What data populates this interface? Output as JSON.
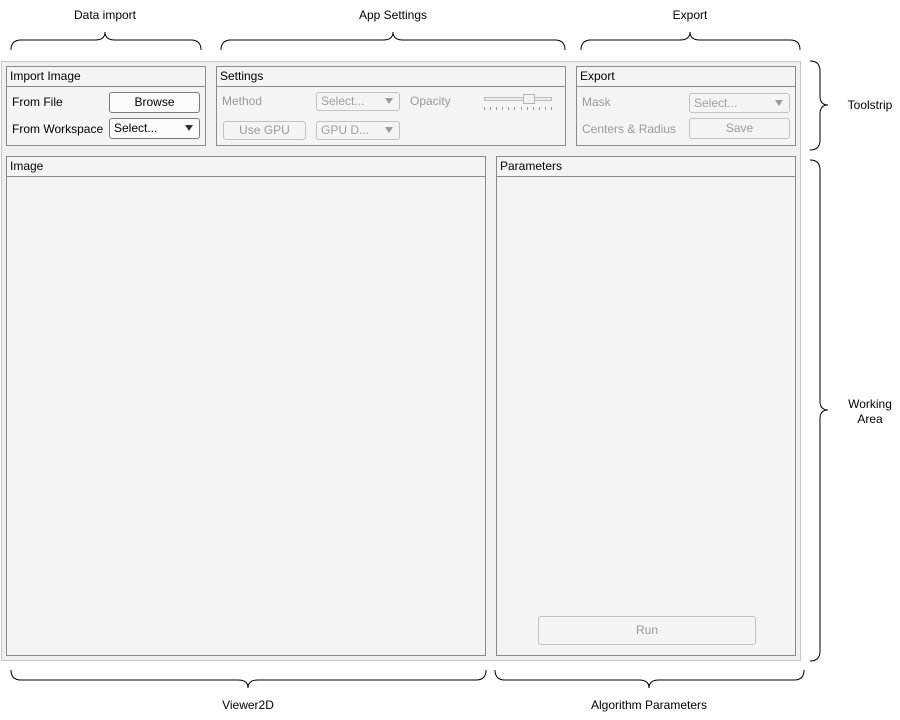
{
  "annotations": {
    "data_import": "Data import",
    "app_settings": "App Settings",
    "export": "Export",
    "toolstrip": "Toolstrip",
    "working_area_line1": "Working",
    "working_area_line2": "Area",
    "viewer2d": "Viewer2D",
    "algorithm_parameters": "Algorithm Parameters"
  },
  "import_panel": {
    "title": "Import Image",
    "from_file_label": "From File",
    "browse_label": "Browse",
    "from_workspace_label": "From Workspace",
    "workspace_select": "Select..."
  },
  "settings_panel": {
    "title": "Settings",
    "method_label": "Method",
    "method_select": "Select...",
    "opacity_label": "Opacity",
    "opacity_value": 0.7,
    "use_gpu_label": "Use GPU",
    "gpu_select": "GPU D..."
  },
  "export_panel": {
    "title": "Export",
    "mask_label": "Mask",
    "mask_select": "Select...",
    "centers_label": "Centers & Radius",
    "save_label": "Save"
  },
  "image_panel": {
    "title": "Image"
  },
  "parameters_panel": {
    "title": "Parameters",
    "run_label": "Run"
  }
}
